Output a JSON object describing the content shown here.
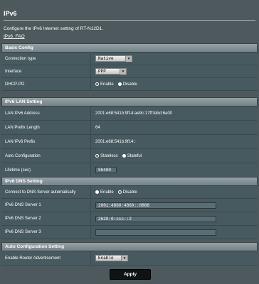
{
  "page": {
    "title": "IPv6",
    "description": "Configure the IPv6 Internet setting of RT-N12D1.",
    "faq_link": "IPv6_FAQ"
  },
  "basic": {
    "header": "Basic Config",
    "connection_type_label": "Connection type",
    "connection_type_value": "Native",
    "interface_label": "Interface",
    "interface_value": "PPP",
    "dhcp_pd_label": "DHCP-PD",
    "dhcp_pd_enable": "Enable",
    "dhcp_pd_disable": "Disable",
    "dhcp_pd_selected": "Disable"
  },
  "lan": {
    "header": "IPv6 LAN Setting",
    "address_label": "LAN IPv6 Address",
    "address_value": "2001:e68:541b:9f14:ae9c:17ff:febd:6a00",
    "prefix_len_label": "LAN Prefix Length",
    "prefix_len_value": "64",
    "prefix_label": "LAN IPv6 Prefix",
    "prefix_value": "2001:e68:541b:9f14::",
    "auto_conf_label": "Auto Configuration",
    "auto_conf_stateless": "Stateless",
    "auto_conf_stateful": "Stateful",
    "auto_conf_selected": "Stateful",
    "lifetime_label": "Lifetime (sec)",
    "lifetime_value": "86400"
  },
  "dns": {
    "header": "IPv6 DNS Setting",
    "auto_label": "Connect to DNS Server automatically",
    "auto_enable": "Enable",
    "auto_disable": "Disable",
    "auto_selected": "Enable",
    "server1_label": "IPv6 DNS Server 1",
    "server1_value": "2001:4860:4860::8888",
    "server2_label": "IPv6 DNS Server 2",
    "server2_value": "2620:0:ccc::2",
    "server3_label": "IPv6 DNS Server 3",
    "server3_value": ""
  },
  "autoconf": {
    "header": "Auto Configuration Setting",
    "router_adv_label": "Enable Router Advertisement",
    "router_adv_value": "Enable"
  },
  "apply_label": "Apply"
}
